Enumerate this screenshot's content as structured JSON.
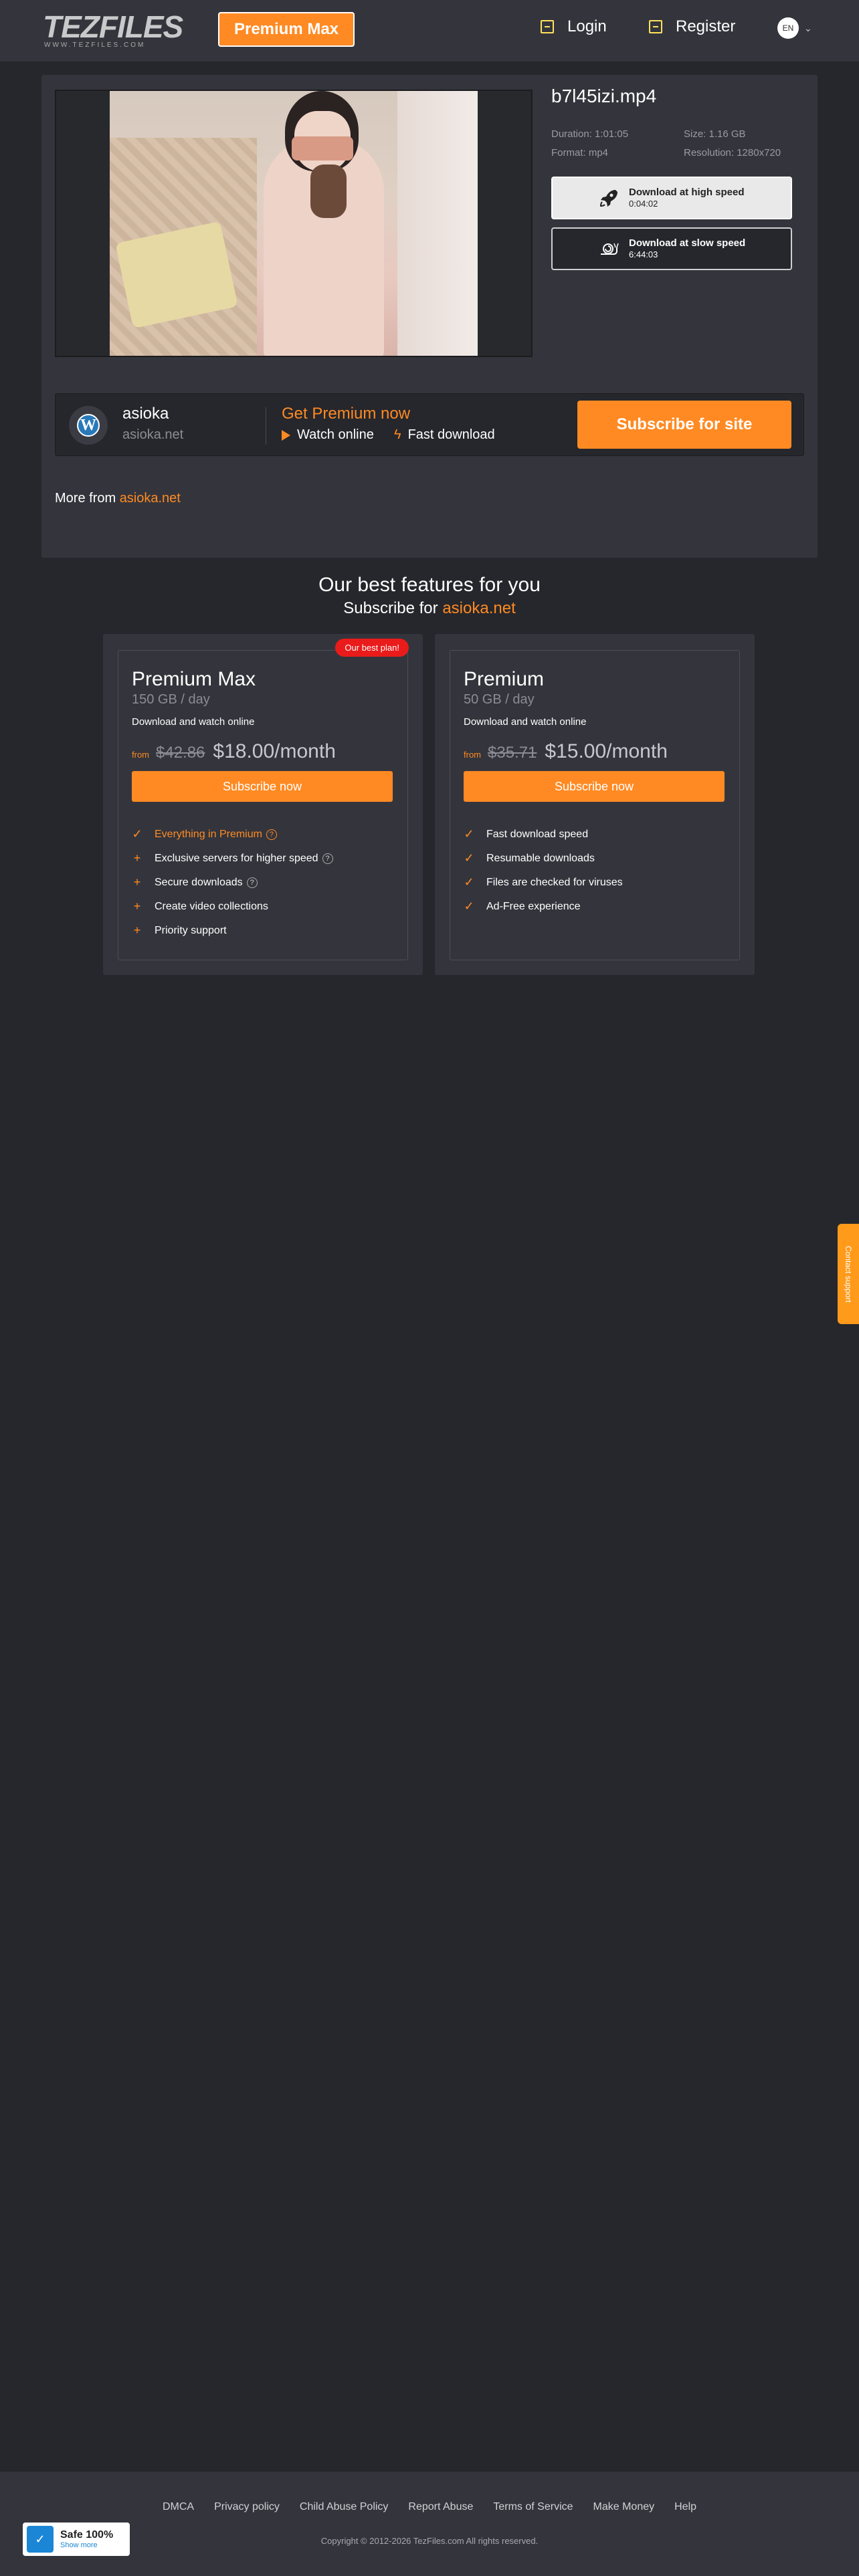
{
  "header": {
    "logo_text": "TEZFILES",
    "logo_sub": "WWW.TEZFILES.COM",
    "premium_label": "Premium Max",
    "login_label": "Login",
    "register_label": "Register",
    "lang_code": "EN"
  },
  "file": {
    "name": "b7l45izi.mp4",
    "duration": "Duration: 1:01:05",
    "size": "Size: 1.16 GB",
    "format": "Format: mp4",
    "resolution": "Resolution: 1280x720"
  },
  "downloads": {
    "fast_label": "Download at high speed",
    "fast_time": "0:04:02",
    "slow_label": "Download at slow speed",
    "slow_time": "6:44:03"
  },
  "site": {
    "name": "asioka",
    "domain": "asioka.net",
    "get_premium": "Get Premium now",
    "watch_online": "Watch online",
    "fast_download": "Fast download",
    "subscribe_label": "Subscribe for site"
  },
  "more_from": {
    "prefix": "More from",
    "link": "asioka.net"
  },
  "features_section": {
    "title": "Our best features for you",
    "subtitle_prefix": "Subscribe for",
    "subtitle_site": "asioka.net"
  },
  "plans": [
    {
      "badge": "Our best plan!",
      "name": "Premium Max",
      "quota": "150 GB / day",
      "desc": "Download and watch online",
      "from": "from",
      "old_price": "$42.86",
      "new_price": "$18.00/month",
      "button": "Subscribe now",
      "features": [
        "Everything in Premium",
        "Exclusive servers for higher speed",
        "Secure downloads",
        "Create video collections",
        "Priority support"
      ]
    },
    {
      "name": "Premium",
      "quota": "50 GB / day",
      "desc": "Download and watch online",
      "from": "from",
      "old_price": "$35.71",
      "new_price": "$15.00/month",
      "button": "Subscribe now",
      "features": [
        "Fast download speed",
        "Resumable downloads",
        "Files are checked for viruses",
        "Ad-Free experience"
      ]
    }
  ],
  "contact_tab": "Contact support",
  "footer": {
    "links": [
      "DMCA",
      "Privacy policy",
      "Child Abuse Policy",
      "Report Abuse",
      "Terms of Service",
      "Make Money",
      "Help"
    ],
    "copyright": "Copyright © 2012-2026 TezFiles.com All rights reserved.",
    "safe_title": "Safe 100%",
    "safe_more": "Show more"
  },
  "colors": {
    "accent": "#ff8a23",
    "badge": "#ea1b1b",
    "background": "#26272c",
    "panel": "#34353c"
  },
  "icons": [
    "login-icon",
    "register-icon",
    "rocket-icon",
    "snail-icon",
    "wordpress-icon",
    "play-icon",
    "bolt-icon",
    "check-icon",
    "plus-icon",
    "help-icon",
    "shield-icon"
  ]
}
